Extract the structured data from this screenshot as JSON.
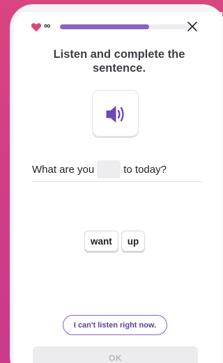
{
  "topbar": {
    "lives_symbol": "∞",
    "progress_fraction": 0.68,
    "accent_color": "#8a64bd",
    "heart_color": "#e0457b"
  },
  "prompt": {
    "title": "Listen and complete the sentence."
  },
  "sentence": {
    "before": "What are you",
    "after": "to today?"
  },
  "choices": [
    "want",
    "up"
  ],
  "actions": {
    "cant_listen_label": "I can't listen right now.",
    "ok_label": "OK"
  },
  "icons": {
    "heart": "heart-icon",
    "close": "close-icon",
    "audio": "speaker-icon"
  }
}
